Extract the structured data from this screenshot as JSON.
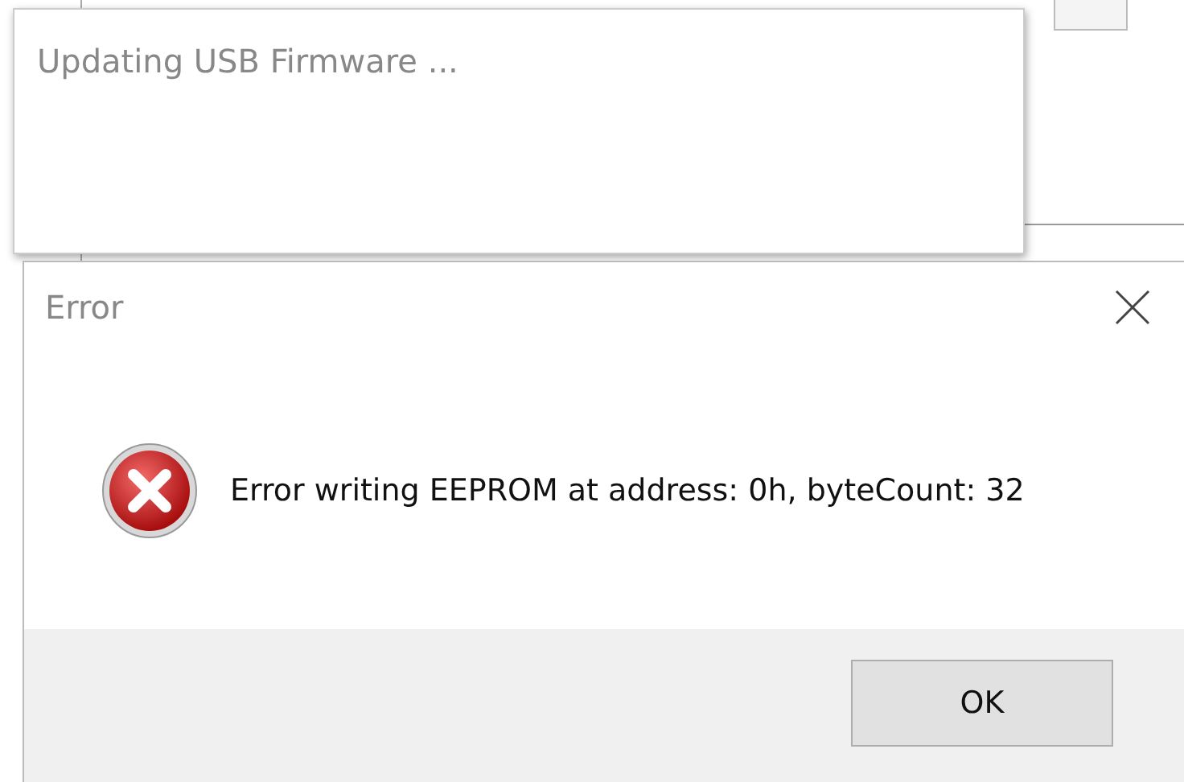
{
  "progress_dialog": {
    "title": "Updating USB Firmware ..."
  },
  "error_dialog": {
    "title": "Error",
    "message": "Error writing EEPROM at address: 0h, byteCount: 32",
    "buttons": [
      "OK"
    ]
  }
}
